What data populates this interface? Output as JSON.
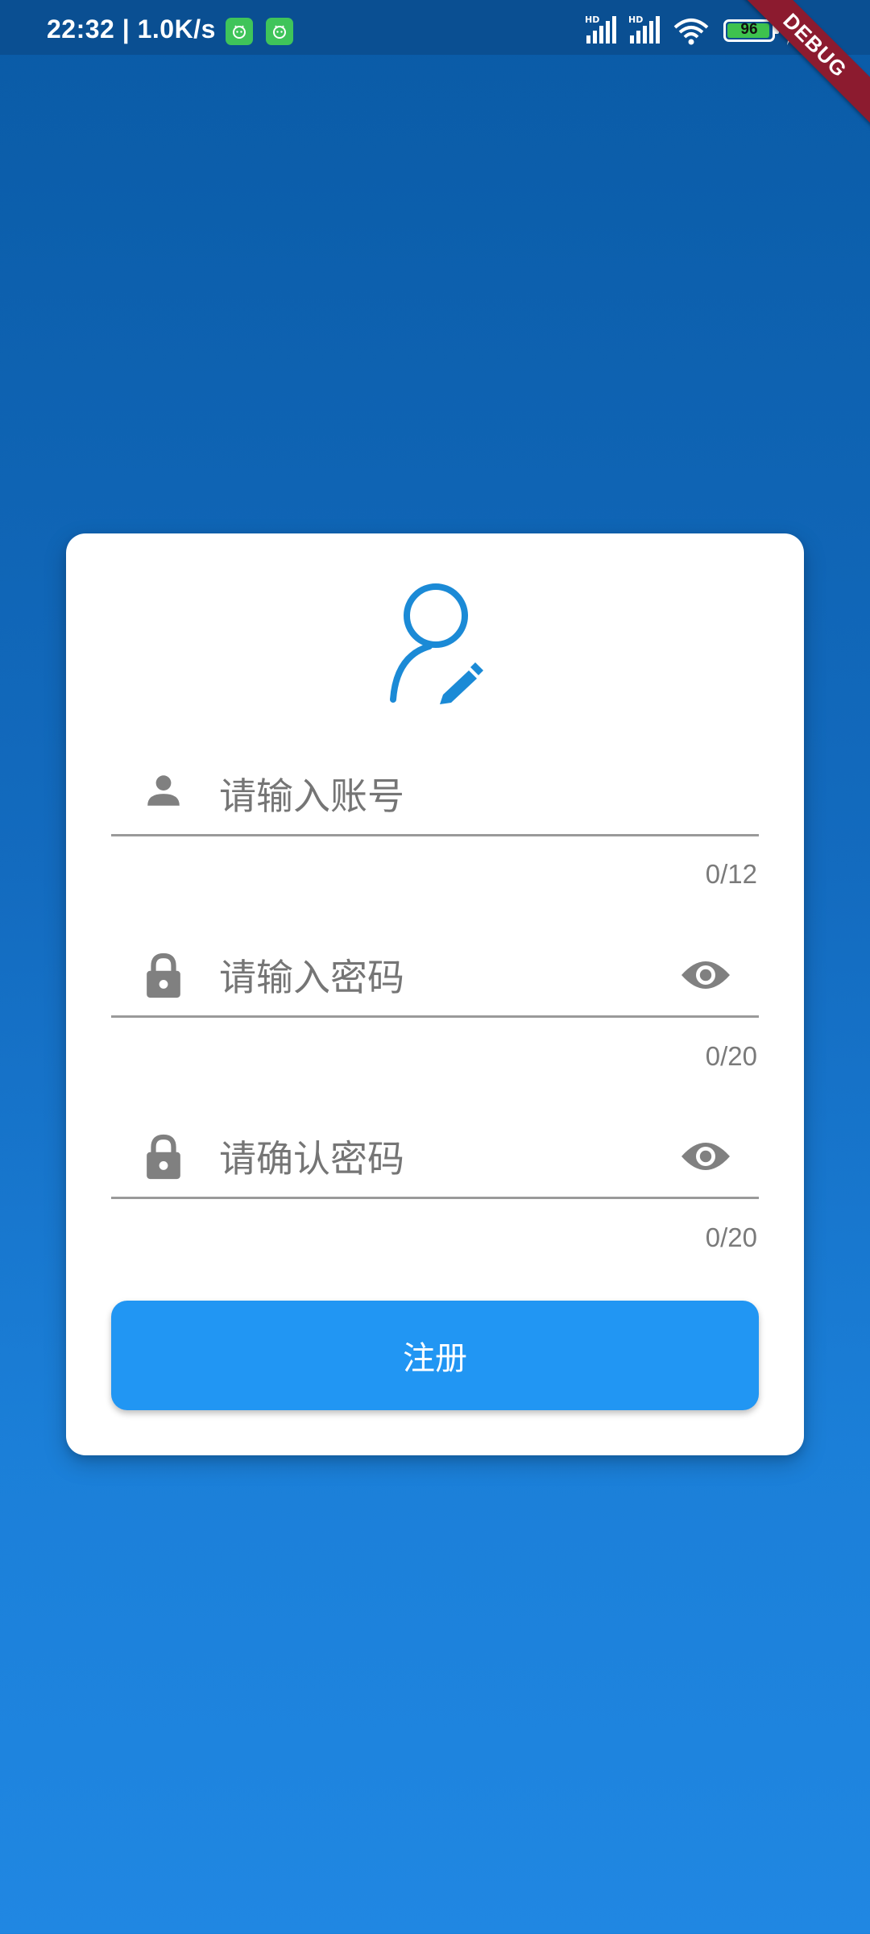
{
  "status_bar": {
    "time": "22:32 | 1.0K/s",
    "signal_1_label": "HD",
    "signal_2_label": "HD",
    "battery": "96",
    "battery_level": 0.96
  },
  "debug_banner": "DEBUG",
  "form": {
    "account": {
      "placeholder": "请输入账号",
      "counter": "0/12"
    },
    "password": {
      "placeholder": "请输入密码",
      "counter": "0/20"
    },
    "confirm_password": {
      "placeholder": "请确认密码",
      "counter": "0/20"
    },
    "register_label": "注册"
  },
  "colors": {
    "primary": "#2196f3",
    "logo": "#1b8ad6",
    "icon": "#808080",
    "battery": "#3ec24e",
    "debug": "#8c1b2f"
  },
  "icons": [
    "android-app-icon",
    "signal-icon",
    "wifi-icon",
    "battery-icon",
    "charging-icon",
    "user-edit-icon",
    "person-icon",
    "lock-icon",
    "eye-icon"
  ]
}
